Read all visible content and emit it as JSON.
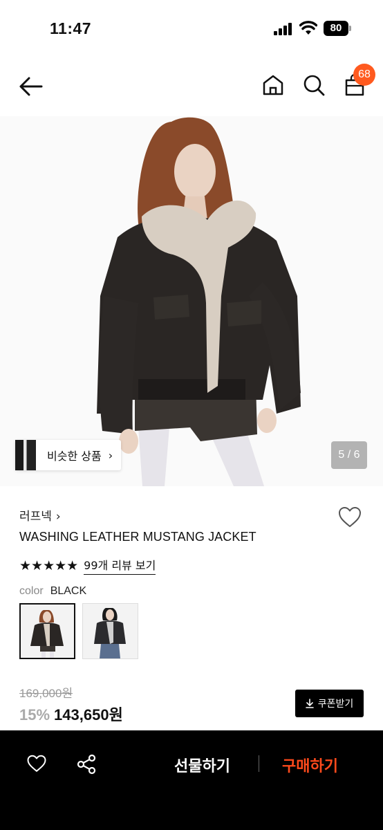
{
  "status_bar": {
    "time": "11:47",
    "battery": "80"
  },
  "header": {
    "cart_count": "68"
  },
  "gallery": {
    "similar_label": "비슷한 상품",
    "pager": "5 / 6"
  },
  "product": {
    "brand": "러프넥",
    "name": "WASHING LEATHER MUSTANG JACKET",
    "stars": "★★★★★",
    "rating_stars": 5,
    "review_link": "99개 리뷰 보기",
    "color_label": "color",
    "color_value": "BLACK",
    "swatches_selected": 0
  },
  "price": {
    "original": "169,000원",
    "discount": "15%",
    "sale": "143,650원",
    "coupon_label": "쿠폰받기"
  },
  "bottom_bar": {
    "gift_label": "선물하기",
    "buy_label": "구매하기"
  },
  "colors": {
    "accent": "#ff5a1f",
    "buy": "#ff4a1c",
    "bar": "#000000"
  }
}
